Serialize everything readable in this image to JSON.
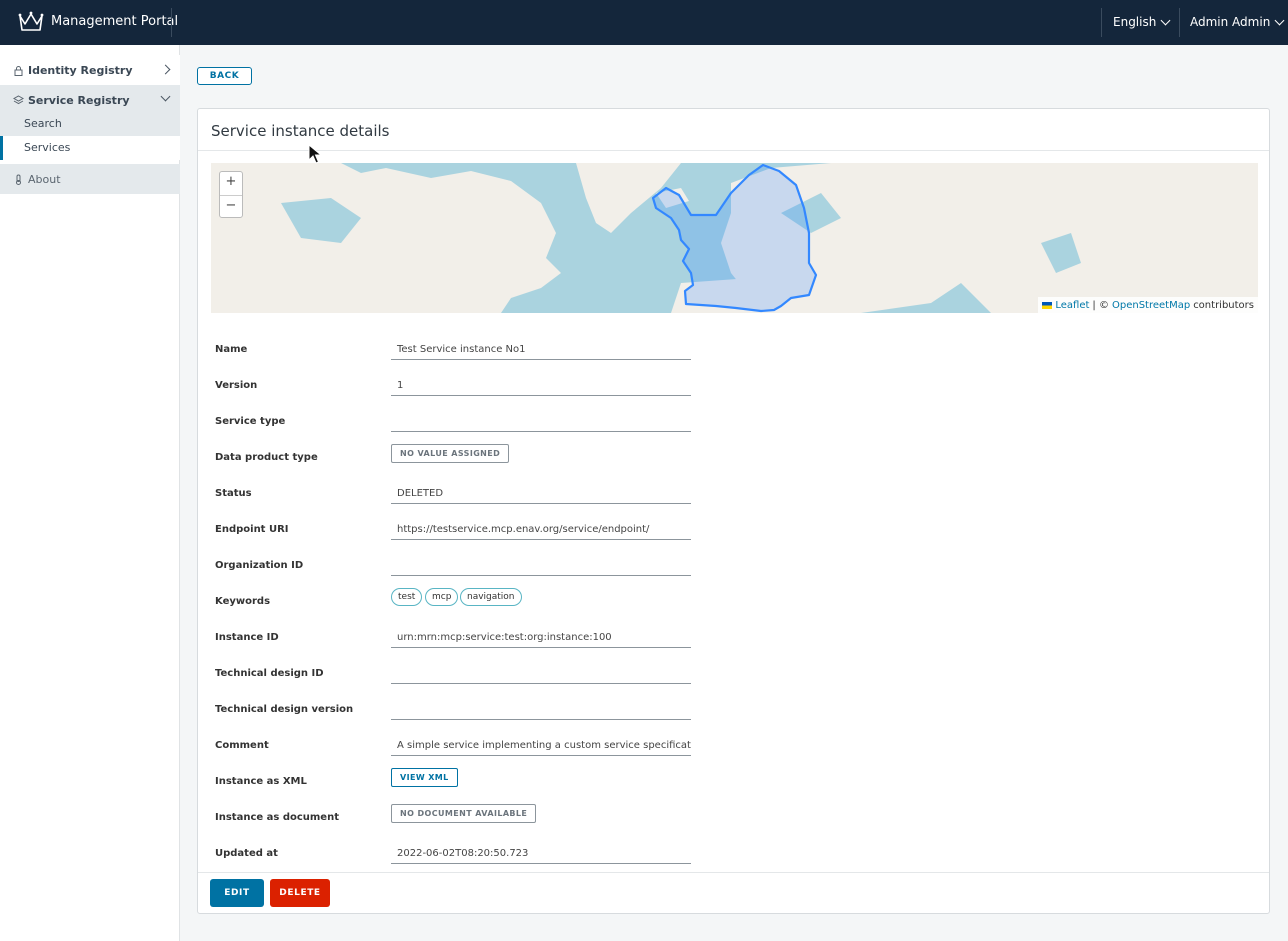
{
  "header": {
    "app_title": "Management Portal",
    "language": "English",
    "user": "Admin Admin"
  },
  "sidebar": {
    "identity_registry": "Identity Registry",
    "service_registry": "Service Registry",
    "items": [
      {
        "label": "Search"
      },
      {
        "label": "Services"
      }
    ],
    "about": "About"
  },
  "back_label": "BACK",
  "card": {
    "title": "Service instance details"
  },
  "map": {
    "zoom_in": "+",
    "zoom_out": "−",
    "attrib_leaflet": "Leaflet",
    "attrib_sep": "| ©",
    "attrib_osm": "OpenStreetMap",
    "attrib_contrib": "contributors",
    "colors": {
      "water": "#aad3df",
      "land": "#f2efe9",
      "polygon": "#3388ff"
    }
  },
  "fields": {
    "name": {
      "label": "Name",
      "value": "Test Service instance No1"
    },
    "version": {
      "label": "Version",
      "value": "1"
    },
    "service_type": {
      "label": "Service type",
      "value": ""
    },
    "data_product_type": {
      "label": "Data product type",
      "value": "NO VALUE ASSIGNED"
    },
    "status": {
      "label": "Status",
      "value": "DELETED"
    },
    "endpoint_uri": {
      "label": "Endpoint URI",
      "value": "https://testservice.mcp.enav.org/service/endpoint/"
    },
    "organization_id": {
      "label": "Organization ID",
      "value": ""
    },
    "keywords": {
      "label": "Keywords",
      "values": [
        "test",
        "mcp",
        "navigation"
      ]
    },
    "instance_id": {
      "label": "Instance ID",
      "value": "urn:mrn:mcp:service:test:org:instance:100"
    },
    "technical_design_id": {
      "label": "Technical design ID",
      "value": ""
    },
    "technical_design_version": {
      "label": "Technical design version",
      "value": ""
    },
    "comment": {
      "label": "Comment",
      "value": "A simple service implementing a custom service specification"
    },
    "instance_xml": {
      "label": "Instance as XML",
      "value": "VIEW XML"
    },
    "instance_doc": {
      "label": "Instance as document",
      "value": "NO DOCUMENT AVAILABLE"
    },
    "updated_at": {
      "label": "Updated at",
      "value": "2022-06-02T08:20:50.723"
    }
  },
  "actions": {
    "edit": "EDIT",
    "delete": "DELETE",
    "colors": {
      "primary": "#0072a3",
      "danger": "#db2100"
    }
  }
}
